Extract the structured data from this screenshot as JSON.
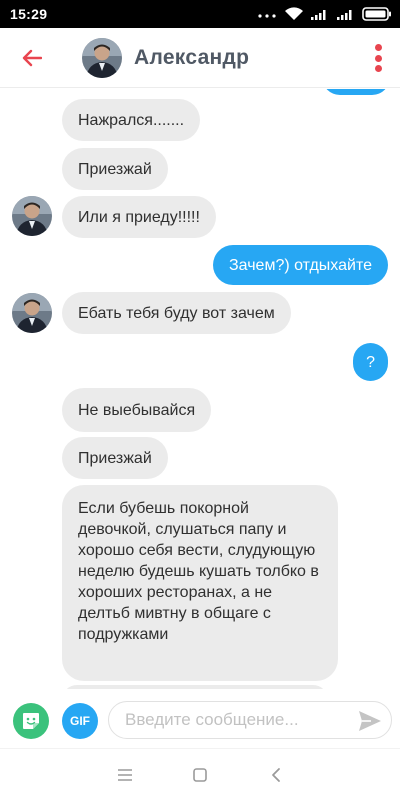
{
  "status_bar": {
    "time": "15:29"
  },
  "header": {
    "contact_name": "Александр"
  },
  "messages": [
    {
      "from": "them",
      "text": "Нажрался......."
    },
    {
      "from": "them",
      "text": "Приезжай"
    },
    {
      "from": "them",
      "text": "Или я приеду!!!!!"
    },
    {
      "from": "me",
      "text": "Зачем?) отдыхайте"
    },
    {
      "from": "them",
      "text": "Ебать тебя буду вот зачем"
    },
    {
      "from": "me",
      "text": "?"
    },
    {
      "from": "them",
      "text": "Не выебывайся"
    },
    {
      "from": "them",
      "text": "Приезжай"
    },
    {
      "from": "them",
      "text": "Если бубешь покорной девочкой, слушаться папу и хорошо себя вести, слудующую неделю будешь кушать толбко в хороших ресторанах, а не делтьб мивтну в общаге с подружками"
    }
  ],
  "composer": {
    "gif_label": "GIF",
    "placeholder": "Введите сообщение..."
  },
  "colors": {
    "incoming_bubble": "#ebebeb",
    "outgoing_bubble": "#27a7f3",
    "accent": "#e8454f",
    "sticker_button": "#3bc27c"
  },
  "icons": [
    "back-arrow-icon",
    "more-vertical-icon",
    "sticker-icon",
    "send-icon",
    "menu-lines-icon",
    "home-square-icon",
    "back-chevron-icon",
    "wifi-icon",
    "signal-icon",
    "battery-icon"
  ]
}
